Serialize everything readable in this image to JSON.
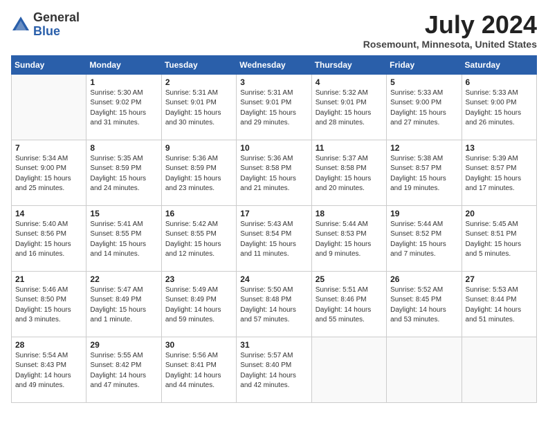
{
  "header": {
    "logo_general": "General",
    "logo_blue": "Blue",
    "month_title": "July 2024",
    "location": "Rosemount, Minnesota, United States"
  },
  "weekdays": [
    "Sunday",
    "Monday",
    "Tuesday",
    "Wednesday",
    "Thursday",
    "Friday",
    "Saturday"
  ],
  "weeks": [
    [
      null,
      {
        "day": 1,
        "sunrise": "5:30 AM",
        "sunset": "9:02 PM",
        "daylight": "15 hours and 31 minutes."
      },
      {
        "day": 2,
        "sunrise": "5:31 AM",
        "sunset": "9:01 PM",
        "daylight": "15 hours and 30 minutes."
      },
      {
        "day": 3,
        "sunrise": "5:31 AM",
        "sunset": "9:01 PM",
        "daylight": "15 hours and 29 minutes."
      },
      {
        "day": 4,
        "sunrise": "5:32 AM",
        "sunset": "9:01 PM",
        "daylight": "15 hours and 28 minutes."
      },
      {
        "day": 5,
        "sunrise": "5:33 AM",
        "sunset": "9:00 PM",
        "daylight": "15 hours and 27 minutes."
      },
      {
        "day": 6,
        "sunrise": "5:33 AM",
        "sunset": "9:00 PM",
        "daylight": "15 hours and 26 minutes."
      }
    ],
    [
      {
        "day": 7,
        "sunrise": "5:34 AM",
        "sunset": "9:00 PM",
        "daylight": "15 hours and 25 minutes."
      },
      {
        "day": 8,
        "sunrise": "5:35 AM",
        "sunset": "8:59 PM",
        "daylight": "15 hours and 24 minutes."
      },
      {
        "day": 9,
        "sunrise": "5:36 AM",
        "sunset": "8:59 PM",
        "daylight": "15 hours and 23 minutes."
      },
      {
        "day": 10,
        "sunrise": "5:36 AM",
        "sunset": "8:58 PM",
        "daylight": "15 hours and 21 minutes."
      },
      {
        "day": 11,
        "sunrise": "5:37 AM",
        "sunset": "8:58 PM",
        "daylight": "15 hours and 20 minutes."
      },
      {
        "day": 12,
        "sunrise": "5:38 AM",
        "sunset": "8:57 PM",
        "daylight": "15 hours and 19 minutes."
      },
      {
        "day": 13,
        "sunrise": "5:39 AM",
        "sunset": "8:57 PM",
        "daylight": "15 hours and 17 minutes."
      }
    ],
    [
      {
        "day": 14,
        "sunrise": "5:40 AM",
        "sunset": "8:56 PM",
        "daylight": "15 hours and 16 minutes."
      },
      {
        "day": 15,
        "sunrise": "5:41 AM",
        "sunset": "8:55 PM",
        "daylight": "15 hours and 14 minutes."
      },
      {
        "day": 16,
        "sunrise": "5:42 AM",
        "sunset": "8:55 PM",
        "daylight": "15 hours and 12 minutes."
      },
      {
        "day": 17,
        "sunrise": "5:43 AM",
        "sunset": "8:54 PM",
        "daylight": "15 hours and 11 minutes."
      },
      {
        "day": 18,
        "sunrise": "5:44 AM",
        "sunset": "8:53 PM",
        "daylight": "15 hours and 9 minutes."
      },
      {
        "day": 19,
        "sunrise": "5:44 AM",
        "sunset": "8:52 PM",
        "daylight": "15 hours and 7 minutes."
      },
      {
        "day": 20,
        "sunrise": "5:45 AM",
        "sunset": "8:51 PM",
        "daylight": "15 hours and 5 minutes."
      }
    ],
    [
      {
        "day": 21,
        "sunrise": "5:46 AM",
        "sunset": "8:50 PM",
        "daylight": "15 hours and 3 minutes."
      },
      {
        "day": 22,
        "sunrise": "5:47 AM",
        "sunset": "8:49 PM",
        "daylight": "15 hours and 1 minute."
      },
      {
        "day": 23,
        "sunrise": "5:49 AM",
        "sunset": "8:49 PM",
        "daylight": "14 hours and 59 minutes."
      },
      {
        "day": 24,
        "sunrise": "5:50 AM",
        "sunset": "8:48 PM",
        "daylight": "14 hours and 57 minutes."
      },
      {
        "day": 25,
        "sunrise": "5:51 AM",
        "sunset": "8:46 PM",
        "daylight": "14 hours and 55 minutes."
      },
      {
        "day": 26,
        "sunrise": "5:52 AM",
        "sunset": "8:45 PM",
        "daylight": "14 hours and 53 minutes."
      },
      {
        "day": 27,
        "sunrise": "5:53 AM",
        "sunset": "8:44 PM",
        "daylight": "14 hours and 51 minutes."
      }
    ],
    [
      {
        "day": 28,
        "sunrise": "5:54 AM",
        "sunset": "8:43 PM",
        "daylight": "14 hours and 49 minutes."
      },
      {
        "day": 29,
        "sunrise": "5:55 AM",
        "sunset": "8:42 PM",
        "daylight": "14 hours and 47 minutes."
      },
      {
        "day": 30,
        "sunrise": "5:56 AM",
        "sunset": "8:41 PM",
        "daylight": "14 hours and 44 minutes."
      },
      {
        "day": 31,
        "sunrise": "5:57 AM",
        "sunset": "8:40 PM",
        "daylight": "14 hours and 42 minutes."
      },
      null,
      null,
      null
    ]
  ],
  "label_sunrise": "Sunrise:",
  "label_sunset": "Sunset:",
  "label_daylight": "Daylight:"
}
